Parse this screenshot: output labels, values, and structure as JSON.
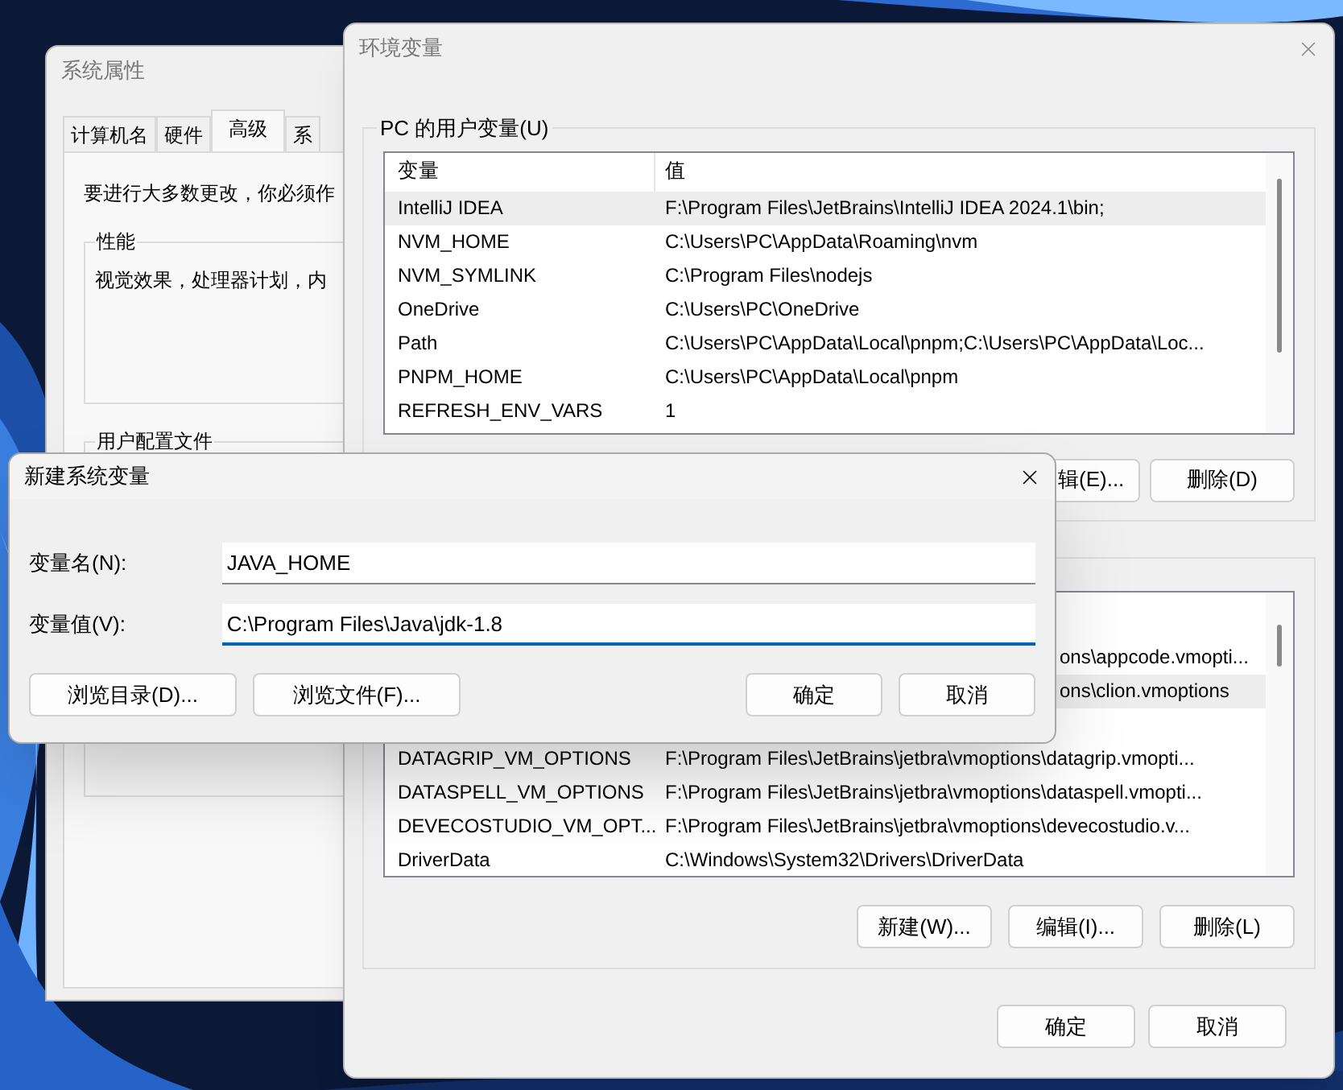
{
  "system_properties": {
    "title": "系统属性",
    "tabs": [
      {
        "label": "计算机名",
        "selected": false
      },
      {
        "label": "硬件",
        "selected": false
      },
      {
        "label": "高级",
        "selected": true
      },
      {
        "label": "系",
        "selected": false
      }
    ],
    "notice": "要进行大多数更改，你必须作",
    "groups": [
      {
        "title": "性能",
        "text": "视觉效果，处理器计划，内"
      },
      {
        "title": "用户配置文件"
      }
    ]
  },
  "environment_variables": {
    "title": "环境变量",
    "user_variables": {
      "title": "PC 的用户变量(U)",
      "columns": [
        "变量",
        "值"
      ],
      "rows": [
        {
          "name": "IntelliJ IDEA",
          "value": "F:\\Program Files\\JetBrains\\IntelliJ IDEA 2024.1\\bin;",
          "selected": true
        },
        {
          "name": "NVM_HOME",
          "value": "C:\\Users\\PC\\AppData\\Roaming\\nvm",
          "selected": false
        },
        {
          "name": "NVM_SYMLINK",
          "value": "C:\\Program Files\\nodejs",
          "selected": false
        },
        {
          "name": "OneDrive",
          "value": "C:\\Users\\PC\\OneDrive",
          "selected": false
        },
        {
          "name": "Path",
          "value": "C:\\Users\\PC\\AppData\\Local\\pnpm;C:\\Users\\PC\\AppData\\Loc...",
          "selected": false
        },
        {
          "name": "PNPM_HOME",
          "value": "C:\\Users\\PC\\AppData\\Local\\pnpm",
          "selected": false
        },
        {
          "name": "REFRESH_ENV_VARS",
          "value": "1",
          "selected": false
        }
      ],
      "buttons": [
        "辑(E)...",
        "删除(D)"
      ]
    },
    "system_variables": {
      "rows": [
        {
          "value": "ons\\appcode.vmopti...",
          "selected": false
        },
        {
          "value": "ons\\clion.vmoptions",
          "selected": true
        },
        {
          "name": "DATAGRIP_VM_OPTIONS",
          "value": "F:\\Program Files\\JetBrains\\jetbra\\vmoptions\\datagrip.vmopti...",
          "selected": false
        },
        {
          "name": "DATASPELL_VM_OPTIONS",
          "value": "F:\\Program Files\\JetBrains\\jetbra\\vmoptions\\dataspell.vmopti...",
          "selected": false
        },
        {
          "name": "DEVECOSTUDIO_VM_OPT...",
          "value": "F:\\Program Files\\JetBrains\\jetbra\\vmoptions\\devecostudio.v...",
          "selected": false
        },
        {
          "name": "DriverData",
          "value": "C:\\Windows\\System32\\Drivers\\DriverData",
          "selected": false
        }
      ],
      "buttons": [
        "新建(W)...",
        "编辑(I)...",
        "删除(L)"
      ]
    },
    "buttons": [
      "确定",
      "取消"
    ]
  },
  "new_system_variable": {
    "title": "新建系统变量",
    "fields": [
      {
        "label": "变量名(N):",
        "value": "JAVA_HOME",
        "focused": false
      },
      {
        "label": "变量值(V):",
        "value": "C:\\Program Files\\Java\\jdk-1.8",
        "focused": true
      }
    ],
    "browse_buttons": [
      "浏览目录(D)...",
      "浏览文件(F)..."
    ],
    "buttons": [
      "确定",
      "取消"
    ]
  }
}
